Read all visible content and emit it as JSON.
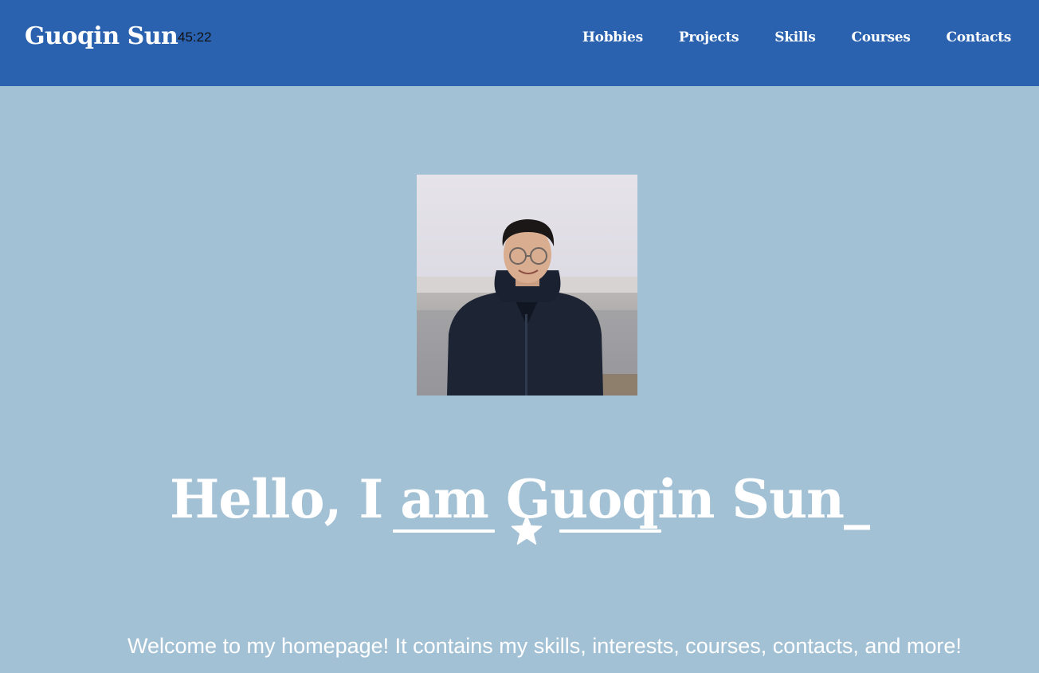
{
  "header": {
    "brand": "Guoqin Sun",
    "clock": "45:22",
    "nav": [
      {
        "label": "Hobbies"
      },
      {
        "label": "Projects"
      },
      {
        "label": "Skills"
      },
      {
        "label": "Courses"
      },
      {
        "label": "Contacts"
      }
    ]
  },
  "hero": {
    "photo_icon": "profile-photo",
    "headline": "Hello, I am Guoqin Sun_",
    "divider_icon": "star-icon",
    "welcome": "Welcome to my homepage! It contains my skills, interests, courses, contacts, and more!"
  },
  "colors": {
    "navbar": "#2a62b0",
    "background": "#a3c1d5",
    "text": "#ffffff"
  }
}
